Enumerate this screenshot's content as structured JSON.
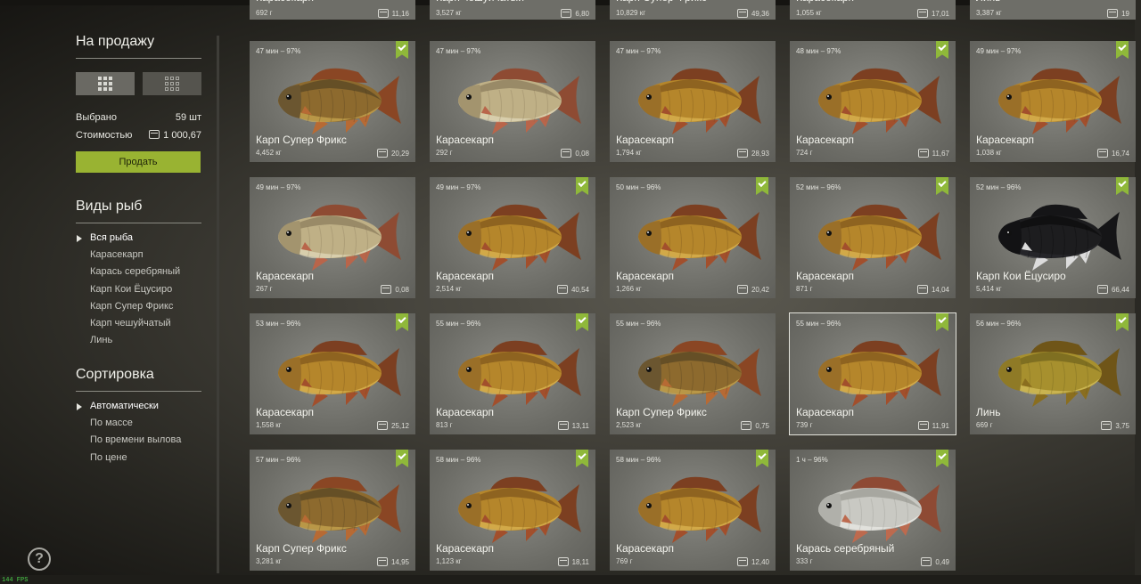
{
  "sidebar": {
    "sale_title": "На продажу",
    "selected_label": "Выбрано",
    "selected_value": "59 шт",
    "cost_label": "Стоимостью",
    "cost_value": "1 000,67",
    "sell_button": "Продать",
    "species_title": "Виды рыб",
    "species": [
      "Вся рыба",
      "Карасекарп",
      "Карась серебряный",
      "Карп Кои Ёцусиро",
      "Карп Супер Фрикс",
      "Карп чешуйчатый",
      "Линь"
    ],
    "species_selected": "Вся рыба",
    "sort_title": "Сортировка",
    "sort_options": [
      "Автоматически",
      "По массе",
      "По времени вылова",
      "По цене"
    ],
    "sort_selected": "Автоматически",
    "help": "?"
  },
  "top_row": [
    {
      "name": "Карасекарп",
      "weight": "692 г",
      "price": "11,16"
    },
    {
      "name": "Карп чешуйчатый",
      "weight": "3,527 кг",
      "price": "6,80"
    },
    {
      "name": "Карп Супер Фрикс",
      "weight": "10,829 кг",
      "price": "49,36"
    },
    {
      "name": "Карасекарп",
      "weight": "1,055 кг",
      "price": "17,01"
    },
    {
      "name": "Линь",
      "weight": "3,387 кг",
      "price": "19"
    }
  ],
  "cards": [
    {
      "time": "47 мин – 97%",
      "name": "Карп Супер Фрикс",
      "weight": "4,452 кг",
      "price": "20,29",
      "type": "mirror",
      "checked": true
    },
    {
      "time": "47 мин – 97%",
      "name": "Карасекарп",
      "weight": "292 г",
      "price": "0,08",
      "type": "pale",
      "checked": false
    },
    {
      "time": "47 мин – 97%",
      "name": "Карасекарп",
      "weight": "1,794 кг",
      "price": "28,93",
      "type": "gold",
      "checked": false
    },
    {
      "time": "48 мин – 97%",
      "name": "Карасекарп",
      "weight": "724 г",
      "price": "11,67",
      "type": "gold",
      "checked": true
    },
    {
      "time": "49 мин – 97%",
      "name": "Карасекарп",
      "weight": "1,038 кг",
      "price": "16,74",
      "type": "gold",
      "checked": true
    },
    {
      "time": "49 мин – 97%",
      "name": "Карасекарп",
      "weight": "267 г",
      "price": "0,08",
      "type": "pale",
      "checked": false
    },
    {
      "time": "49 мин – 97%",
      "name": "Карасекарп",
      "weight": "2,514 кг",
      "price": "40,54",
      "type": "gold",
      "checked": true
    },
    {
      "time": "50 мин – 96%",
      "name": "Карасекарп",
      "weight": "1,266 кг",
      "price": "20,42",
      "type": "gold",
      "checked": true
    },
    {
      "time": "52 мин – 96%",
      "name": "Карасекарп",
      "weight": "871 г",
      "price": "14,04",
      "type": "gold",
      "checked": true
    },
    {
      "time": "52 мин – 96%",
      "name": "Карп Кои Ёцусиро",
      "weight": "5,414 кг",
      "price": "66,44",
      "type": "koi",
      "checked": true
    },
    {
      "time": "53 мин – 96%",
      "name": "Карасекарп",
      "weight": "1,558 кг",
      "price": "25,12",
      "type": "gold",
      "checked": true
    },
    {
      "time": "55 мин – 96%",
      "name": "Карасекарп",
      "weight": "813 г",
      "price": "13,11",
      "type": "gold",
      "checked": true
    },
    {
      "time": "55 мин – 96%",
      "name": "Карп Супер Фрикс",
      "weight": "2,523 кг",
      "price": "0,75",
      "type": "mirror",
      "checked": false
    },
    {
      "time": "55 мин – 96%",
      "name": "Карасекарп",
      "weight": "739 г",
      "price": "11,91",
      "type": "gold",
      "checked": true,
      "highlight": true
    },
    {
      "time": "56 мин – 96%",
      "name": "Линь",
      "weight": "669 г",
      "price": "3,75",
      "type": "tench",
      "checked": true
    },
    {
      "time": "57 мин – 96%",
      "name": "Карп Супер Фрикс",
      "weight": "3,281 кг",
      "price": "14,95",
      "type": "mirror",
      "checked": true
    },
    {
      "time": "58 мин – 96%",
      "name": "Карасекарп",
      "weight": "1,123 кг",
      "price": "18,11",
      "type": "gold",
      "checked": true
    },
    {
      "time": "58 мин – 96%",
      "name": "Карасекарп",
      "weight": "769 г",
      "price": "12,40",
      "type": "gold",
      "checked": true
    },
    {
      "time": "1 ч – 96%",
      "name": "Карась серебряный",
      "weight": "333 г",
      "price": "0,49",
      "type": "silver",
      "checked": true
    }
  ],
  "colors": {
    "accent": "#99b332",
    "badge": "#8fb83a",
    "card": "#6c6c66",
    "background": "#3a3832"
  },
  "fps": "144 FPS"
}
